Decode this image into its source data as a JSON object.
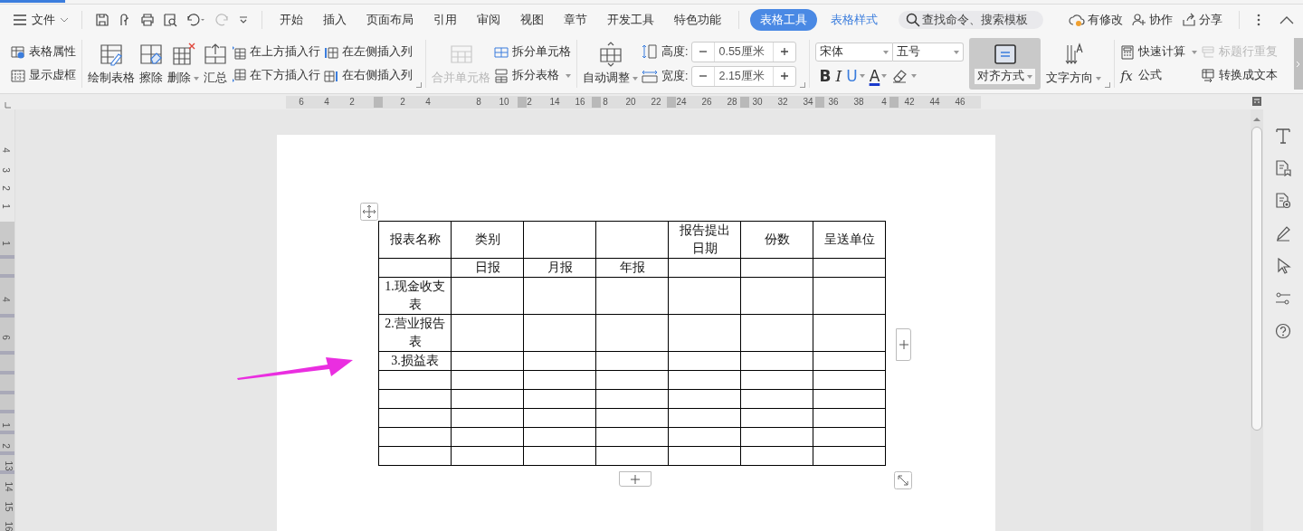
{
  "menu_bar": {
    "file_menu": "文件",
    "tabs": [
      {
        "label": "开始",
        "selected": false
      },
      {
        "label": "插入",
        "selected": false
      },
      {
        "label": "页面布局",
        "selected": false
      },
      {
        "label": "引用",
        "selected": false
      },
      {
        "label": "审阅",
        "selected": false
      },
      {
        "label": "视图",
        "selected": false
      },
      {
        "label": "章节",
        "selected": false
      },
      {
        "label": "开发工具",
        "selected": false
      },
      {
        "label": "特色功能",
        "selected": false
      },
      {
        "label": "表格工具",
        "selected": true
      },
      {
        "label": "表格样式",
        "selected": false
      }
    ],
    "search": {
      "placeholder": "查找命令、搜索模板"
    },
    "actions": [
      "有修改",
      "协作",
      "分享"
    ]
  },
  "ribbon": {
    "table_properties": "表格属性",
    "show_gridlines": "显示虚框",
    "draw_table": "绘制表格",
    "erase": "擦除",
    "delete": "删除",
    "summary": "汇总",
    "insert_above": "在上方插入行",
    "insert_below": "在下方插入行",
    "insert_left": "在左侧插入列",
    "insert_right": "在右侧插入列",
    "merge_cells": {
      "label": "合并单元格",
      "disabled": true
    },
    "split_cells": "拆分单元格",
    "split_table": "拆分表格",
    "auto_fit": "自动调整",
    "height": {
      "label": "高度:",
      "value": "0.55厘米"
    },
    "width": {
      "label": "宽度:",
      "value": "2.15厘米"
    },
    "font": "宋体",
    "font_size": "五号",
    "bold": "B",
    "italic": "I",
    "underline": "U",
    "font_color": "A",
    "align": {
      "label": "对齐方式",
      "selected": true
    },
    "text_direction": "文字方向",
    "quick_calc": "快速计算",
    "repeat_header": {
      "label": "标题行重复",
      "disabled": true
    },
    "formula_symbol": "fx",
    "formula": "公式",
    "convert_to_text": "转换成文本"
  },
  "ruler": {
    "horizontal": [
      "6",
      "4",
      "2",
      "2",
      "4",
      "8",
      "10",
      "2",
      "14",
      "16",
      "8",
      "20",
      "22",
      "24",
      "26",
      "28",
      "30",
      "32",
      "34",
      "36",
      "38",
      "4",
      "42",
      "44",
      "46"
    ],
    "vertical": [
      "4",
      "3",
      "2",
      "1",
      "1",
      "4",
      "6",
      "1",
      "2",
      "13",
      "14",
      "15",
      "16"
    ]
  },
  "table": {
    "rows": [
      [
        "报表名称",
        "类别",
        null,
        null,
        "报告提出日期",
        "份数",
        "呈送单位"
      ],
      [
        null,
        "日报",
        "月报",
        "年报",
        null,
        null,
        null
      ],
      [
        "1.现金收支表",
        null,
        null,
        null,
        null,
        null,
        null
      ],
      [
        "2.营业报告表",
        null,
        null,
        null,
        null,
        null,
        null
      ],
      [
        "3.损益表",
        null,
        null,
        null,
        null,
        null,
        null
      ],
      [
        null,
        null,
        null,
        null,
        null,
        null,
        null
      ],
      [
        null,
        null,
        null,
        null,
        null,
        null,
        null
      ],
      [
        null,
        null,
        null,
        null,
        null,
        null,
        null
      ],
      [
        null,
        null,
        null,
        null,
        null,
        null,
        null
      ],
      [
        null,
        null,
        null,
        null,
        null,
        null,
        null
      ]
    ]
  }
}
